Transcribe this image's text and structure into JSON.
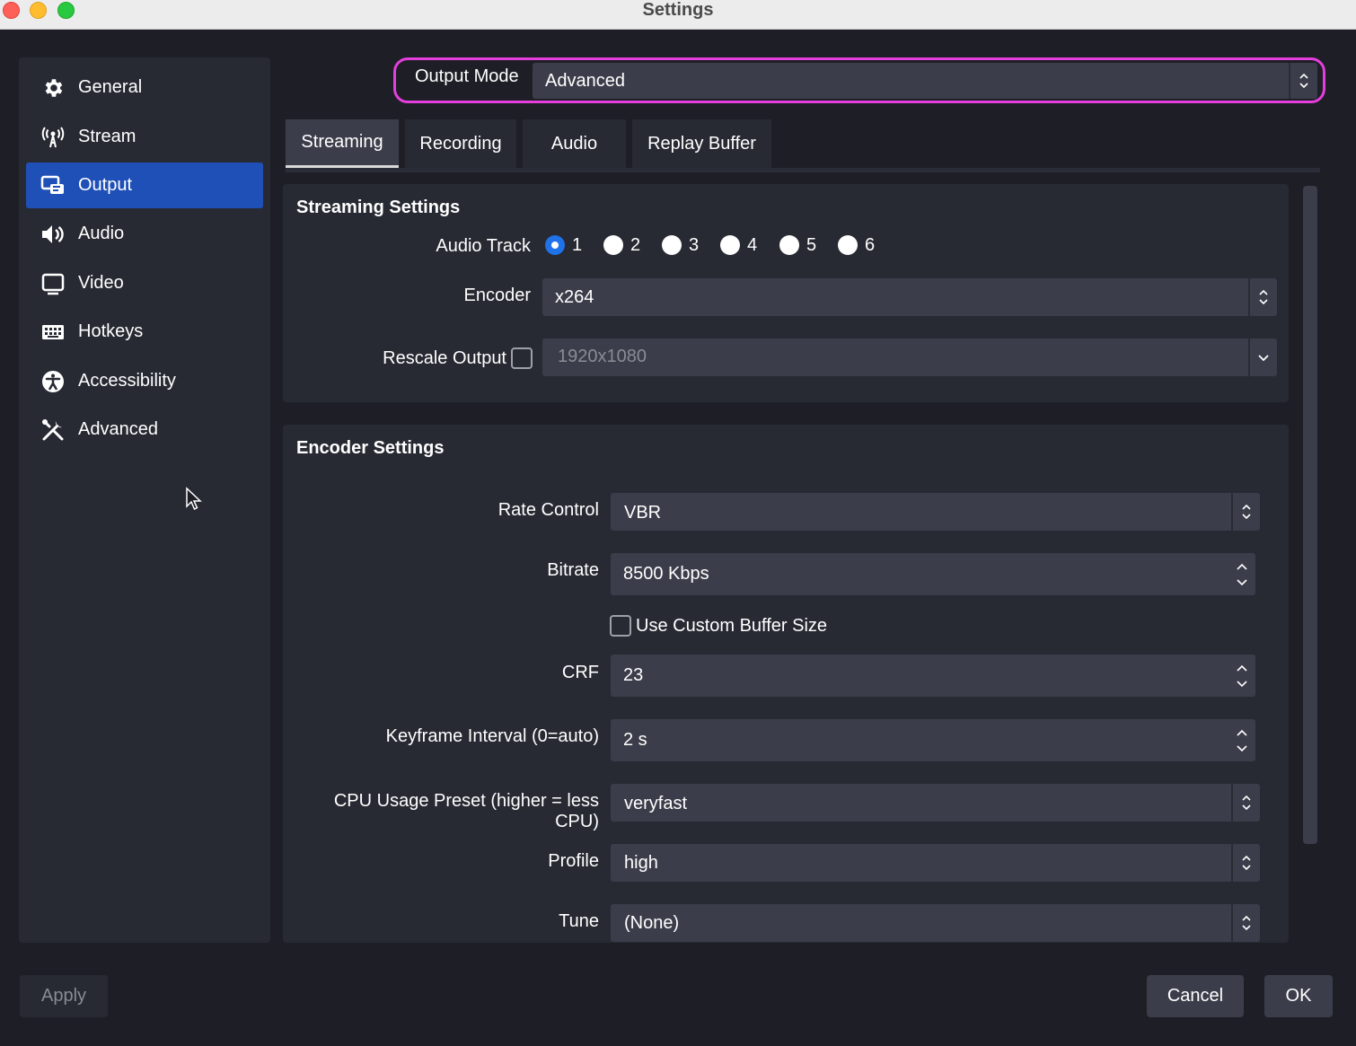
{
  "window": {
    "title": "Settings"
  },
  "sidebar": {
    "items": [
      {
        "label": "General",
        "icon": "gear-icon"
      },
      {
        "label": "Stream",
        "icon": "antenna-icon"
      },
      {
        "label": "Output",
        "icon": "output-icon",
        "active": true
      },
      {
        "label": "Audio",
        "icon": "speaker-icon"
      },
      {
        "label": "Video",
        "icon": "monitor-icon"
      },
      {
        "label": "Hotkeys",
        "icon": "keyboard-icon"
      },
      {
        "label": "Accessibility",
        "icon": "accessibility-icon"
      },
      {
        "label": "Advanced",
        "icon": "tools-icon"
      }
    ]
  },
  "output_mode": {
    "label": "Output Mode",
    "value": "Advanced"
  },
  "tabs": [
    {
      "label": "Streaming",
      "active": true
    },
    {
      "label": "Recording"
    },
    {
      "label": "Audio"
    },
    {
      "label": "Replay Buffer"
    }
  ],
  "streaming": {
    "title": "Streaming Settings",
    "audio_track_label": "Audio Track",
    "audio_tracks": [
      "1",
      "2",
      "3",
      "4",
      "5",
      "6"
    ],
    "audio_track_selected": "1",
    "encoder_label": "Encoder",
    "encoder_value": "x264",
    "rescale_label": "Rescale Output",
    "rescale_checked": false,
    "rescale_value": "1920x1080"
  },
  "encoder": {
    "title": "Encoder Settings",
    "rate_control_label": "Rate Control",
    "rate_control_value": "VBR",
    "bitrate_label": "Bitrate",
    "bitrate_value": "8500 Kbps",
    "custom_buffer_label": "Use Custom Buffer Size",
    "custom_buffer_checked": false,
    "crf_label": "CRF",
    "crf_value": "23",
    "keyframe_label": "Keyframe Interval (0=auto)",
    "keyframe_value": "2 s",
    "cpu_preset_label": "CPU Usage Preset (higher = less CPU)",
    "cpu_preset_value": "veryfast",
    "profile_label": "Profile",
    "profile_value": "high",
    "tune_label": "Tune",
    "tune_value": "(None)"
  },
  "buttons": {
    "apply": "Apply",
    "cancel": "Cancel",
    "ok": "OK"
  },
  "colors": {
    "accent": "#1f50b8",
    "highlight": "#e43fdc",
    "radio": "#1f72e8"
  }
}
